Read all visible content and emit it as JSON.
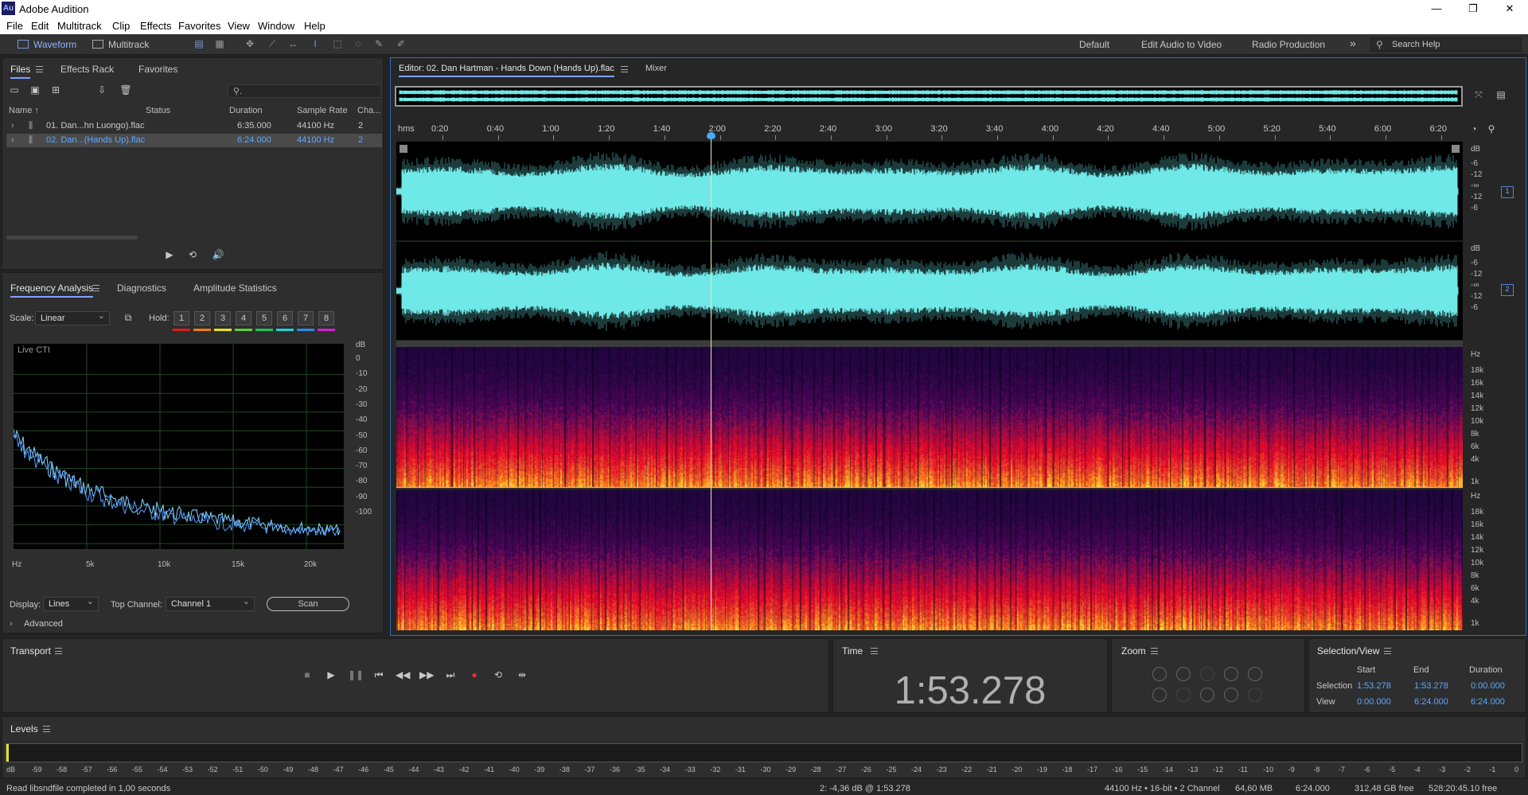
{
  "app": {
    "title": "Adobe Audition",
    "logo_text": "Au",
    "window_controls": [
      "—",
      "❐",
      "✕"
    ]
  },
  "menu": [
    "File",
    "Edit",
    "Multitrack",
    "Clip",
    "Effects",
    "Favorites",
    "View",
    "Window",
    "Help"
  ],
  "toolbar": {
    "waveform_label": "Waveform",
    "multitrack_label": "Multitrack",
    "workspaces": [
      "Default",
      "Edit Audio to Video",
      "Radio Production"
    ],
    "more": "»",
    "search_placeholder": "Search Help"
  },
  "files_panel": {
    "tabs": [
      "Files",
      "Effects Rack",
      "Favorites"
    ],
    "columns": [
      "Name ↑",
      "Status",
      "Duration",
      "Sample Rate",
      "Cha..."
    ],
    "search_glyph": "⚲.",
    "rows": [
      {
        "name": "01. Dan...hn Luongo).flac",
        "status": "",
        "duration": "6:35.000",
        "rate": "44100 Hz",
        "ch": "2",
        "selected": false
      },
      {
        "name": "02. Dan...(Hands Up).flac",
        "status": "",
        "duration": "6:24.000",
        "rate": "44100 Hz",
        "ch": "2",
        "selected": true
      }
    ]
  },
  "analysis_panel": {
    "tabs": [
      "Frequency Analysis",
      "Diagnostics",
      "Amplitude Statistics"
    ],
    "scale_label": "Scale:",
    "scale_value": "Linear",
    "hold_label": "Hold:",
    "hold_buttons": [
      "1",
      "2",
      "3",
      "4",
      "5",
      "6",
      "7",
      "8"
    ],
    "hold_colors": [
      "#e21b1b",
      "#f07d14",
      "#e7e21b",
      "#5bd22a",
      "#22c35a",
      "#20d4d4",
      "#2a8cf0",
      "#d41ed4"
    ],
    "live_label": "Live CTI",
    "db_unit": "dB",
    "db_ticks": [
      "0",
      "-10",
      "-20",
      "-30",
      "-40",
      "-50",
      "-60",
      "-70",
      "-80",
      "-90",
      "-100"
    ],
    "hz_ticks": [
      "Hz",
      "5k",
      "10k",
      "15k",
      "20k"
    ],
    "display_label": "Display:",
    "display_value": "Lines",
    "top_channel_label": "Top Channel:",
    "top_channel_value": "Channel 1",
    "scan_label": "Scan",
    "advanced_label": "Advanced"
  },
  "editor": {
    "tab_title": "Editor: 02. Dan Hartman - Hands Down (Hands Up).flac",
    "mixer_tab": "Mixer",
    "ruler_unit": "hms",
    "ruler_ticks": [
      "0:20",
      "0:40",
      "1:00",
      "1:20",
      "1:40",
      "2:00",
      "2:20",
      "2:40",
      "3:00",
      "3:20",
      "3:40",
      "4:00",
      "4:20",
      "4:40",
      "5:00",
      "5:20",
      "5:40",
      "6:00",
      "6:20"
    ],
    "amp_scale": [
      "dB",
      "-6",
      "-12",
      "-∞",
      "-12",
      "-6"
    ],
    "channel_badges": [
      "1",
      "2"
    ],
    "freq_scale": [
      "Hz",
      "18k",
      "16k",
      "14k",
      "12k",
      "10k",
      "8k",
      "6k",
      "4k",
      "1k"
    ],
    "playhead_fraction": 0.295,
    "waveform_color": "#6fe8e8",
    "total_duration": "6:24.000"
  },
  "transport": {
    "title": "Transport"
  },
  "time_panel": {
    "title": "Time",
    "value": "1:53.278"
  },
  "zoom_panel": {
    "title": "Zoom"
  },
  "selection_panel": {
    "title": "Selection/View",
    "headers": [
      "Start",
      "End",
      "Duration"
    ],
    "rows": [
      {
        "label": "Selection",
        "start": "1:53.278",
        "end": "1:53.278",
        "duration": "0:00.000"
      },
      {
        "label": "View",
        "start": "0:00.000",
        "end": "6:24.000",
        "duration": "6:24.000"
      }
    ]
  },
  "levels_panel": {
    "title": "Levels",
    "ticks": [
      "dB",
      "-59",
      "-58",
      "-57",
      "-56",
      "-55",
      "-54",
      "-53",
      "-52",
      "-51",
      "-50",
      "-49",
      "-48",
      "-47",
      "-46",
      "-45",
      "-44",
      "-43",
      "-42",
      "-41",
      "-40",
      "-39",
      "-38",
      "-37",
      "-36",
      "-35",
      "-34",
      "-33",
      "-32",
      "-31",
      "-30",
      "-29",
      "-28",
      "-27",
      "-26",
      "-25",
      "-24",
      "-23",
      "-22",
      "-21",
      "-20",
      "-19",
      "-18",
      "-17",
      "-16",
      "-15",
      "-14",
      "-13",
      "-12",
      "-11",
      "-10",
      "-9",
      "-8",
      "-7",
      "-6",
      "-5",
      "-4",
      "-3",
      "-2",
      "-1",
      "0"
    ]
  },
  "status_bar": {
    "message": "Read libsndfile completed in 1,00 seconds",
    "cursor": "2: -4,36 dB @ 1:53.278",
    "format": "44100 Hz • 16-bit • 2 Channel",
    "size": "64,60 MB",
    "duration": "6:24.000",
    "free": "312,48 GB free",
    "free_time": "528:20:45.10 free"
  }
}
